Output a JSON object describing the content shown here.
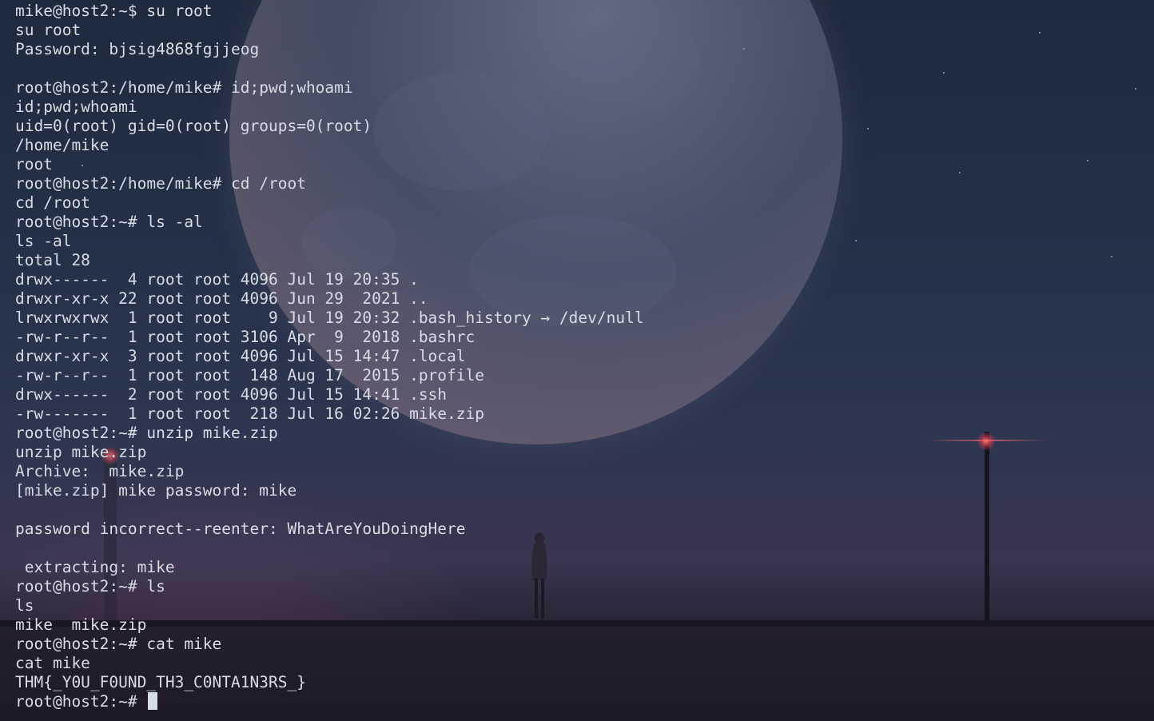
{
  "terminal": {
    "lines": [
      "mike@host2:~$ su root",
      "su root",
      "Password: bjsig4868fgjjeog",
      "",
      "root@host2:/home/mike# id;pwd;whoami",
      "id;pwd;whoami",
      "uid=0(root) gid=0(root) groups=0(root)",
      "/home/mike",
      "root",
      "root@host2:/home/mike# cd /root",
      "cd /root",
      "root@host2:~# ls -al",
      "ls -al",
      "total 28",
      "drwx------  4 root root 4096 Jul 19 20:35 .",
      "drwxr-xr-x 22 root root 4096 Jun 29  2021 ..",
      "lrwxrwxrwx  1 root root    9 Jul 19 20:32 .bash_history → /dev/null",
      "-rw-r--r--  1 root root 3106 Apr  9  2018 .bashrc",
      "drwxr-xr-x  3 root root 4096 Jul 15 14:47 .local",
      "-rw-r--r--  1 root root  148 Aug 17  2015 .profile",
      "drwx------  2 root root 4096 Jul 15 14:41 .ssh",
      "-rw-------  1 root root  218 Jul 16 02:26 mike.zip",
      "root@host2:~# unzip mike.zip",
      "unzip mike.zip",
      "Archive:  mike.zip",
      "[mike.zip] mike password: mike",
      "",
      "password incorrect--reenter: WhatAreYouDoingHere",
      "",
      " extracting: mike",
      "root@host2:~# ls",
      "ls",
      "mike  mike.zip",
      "root@host2:~# cat mike",
      "cat mike",
      "THM{_Y0U_F0UND_TH3_C0NTA1N3RS_}"
    ],
    "prompt": "root@host2:~# "
  }
}
